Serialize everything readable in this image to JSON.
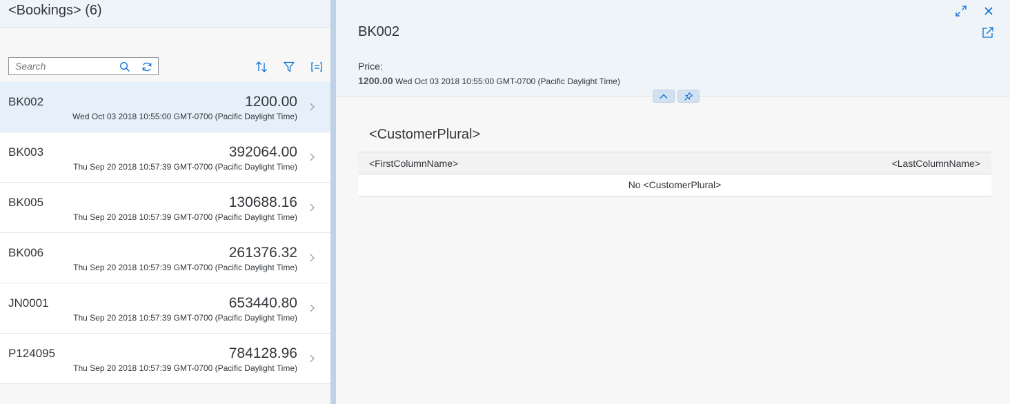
{
  "list": {
    "title": "<Bookings> (6)",
    "search_placeholder": "Search",
    "items": [
      {
        "id": "BK002",
        "amount": "1200.00",
        "date": "Wed Oct 03 2018 10:55:00 GMT-0700 (Pacific Daylight Time)"
      },
      {
        "id": "BK003",
        "amount": "392064.00",
        "date": "Thu Sep 20 2018 10:57:39 GMT-0700 (Pacific Daylight Time)"
      },
      {
        "id": "BK005",
        "amount": "130688.16",
        "date": "Thu Sep 20 2018 10:57:39 GMT-0700 (Pacific Daylight Time)"
      },
      {
        "id": "BK006",
        "amount": "261376.32",
        "date": "Thu Sep 20 2018 10:57:39 GMT-0700 (Pacific Daylight Time)"
      },
      {
        "id": "JN0001",
        "amount": "653440.80",
        "date": "Thu Sep 20 2018 10:57:39 GMT-0700 (Pacific Daylight Time)"
      },
      {
        "id": "P124095",
        "amount": "784128.96",
        "date": "Thu Sep 20 2018 10:57:39 GMT-0700 (Pacific Daylight Time)"
      }
    ]
  },
  "detail": {
    "title": "BK002",
    "price_label": "Price:",
    "price_value": "1200.00",
    "price_date": "Wed Oct 03 2018 10:55:00 GMT-0700 (Pacific Daylight Time)",
    "section_title": "<CustomerPlural>",
    "table": {
      "first_column": "<FirstColumnName>",
      "last_column": "<LastColumnName>",
      "no_data": "No <CustomerPlural>"
    }
  },
  "colors": {
    "accent": "#0a6ed1",
    "header_bg": "#eff4f9",
    "selected_row": "#e5f0fa",
    "splitter": "#bfd1e6"
  },
  "icons": [
    "search-icon",
    "refresh-icon",
    "sort-icon",
    "filter-icon",
    "group-icon",
    "chevron-right-icon",
    "fullscreen-icon",
    "close-icon",
    "share-icon",
    "collapse-header-icon",
    "pin-icon"
  ]
}
